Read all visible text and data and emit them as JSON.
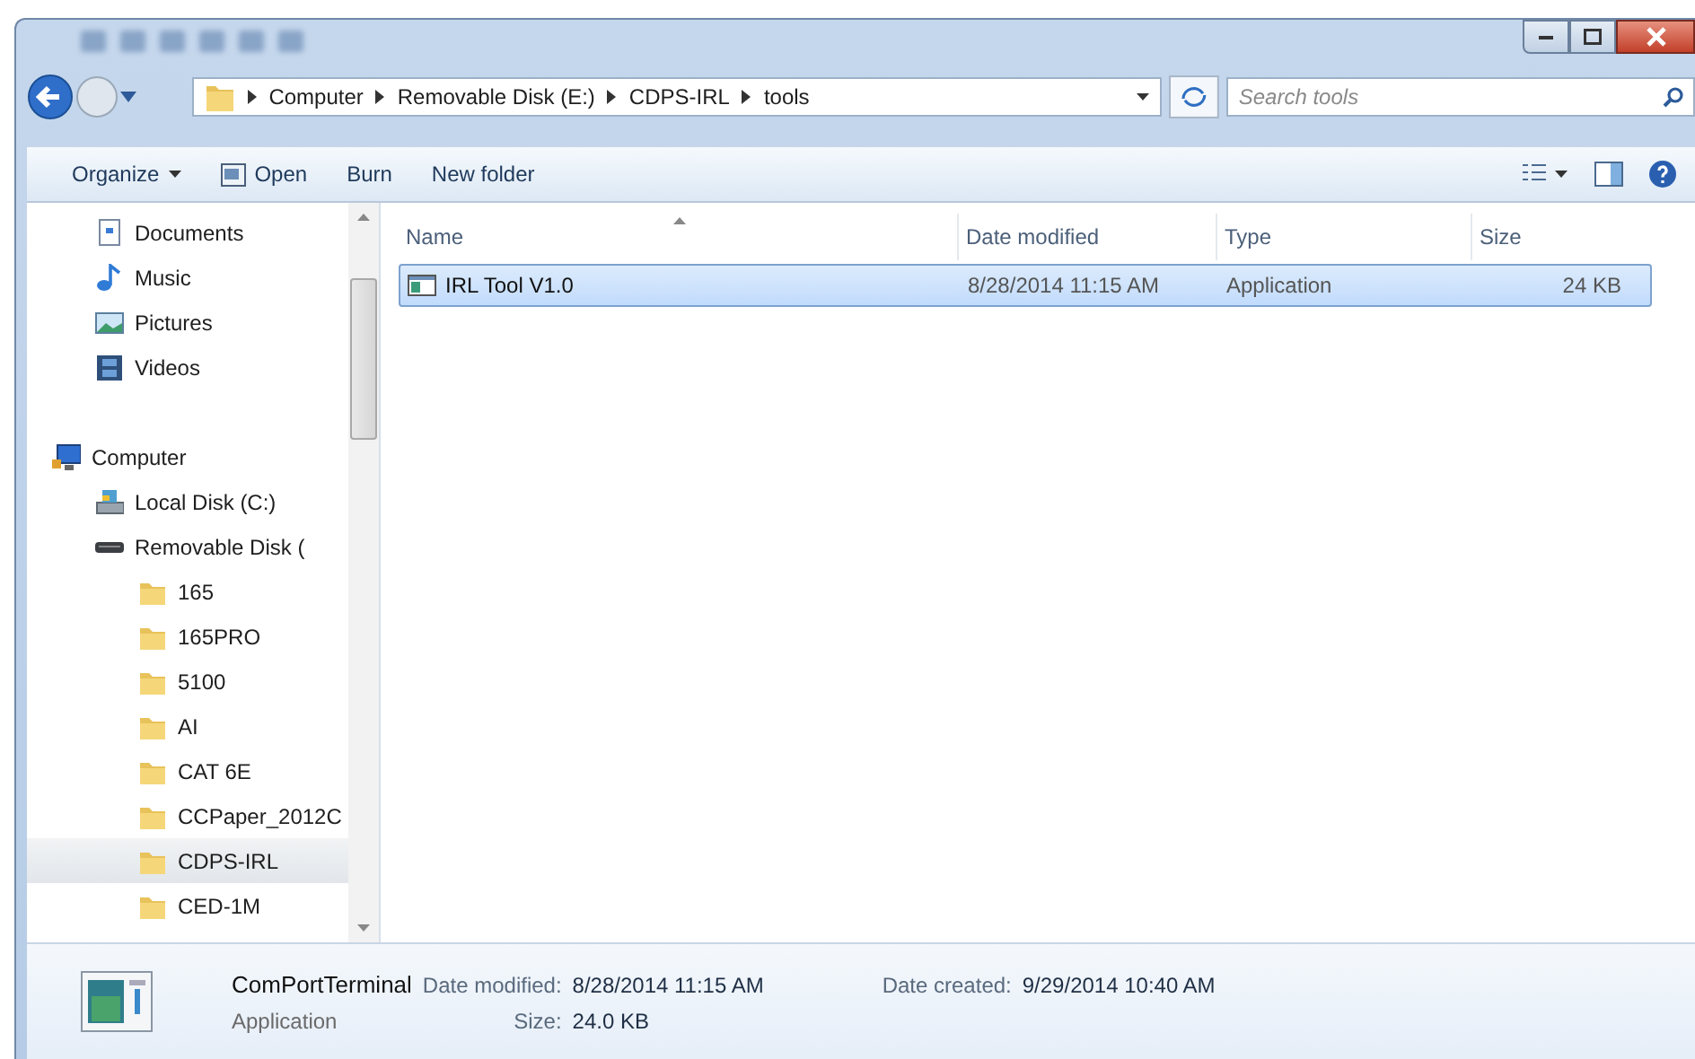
{
  "address_bar": {
    "segments": [
      "Computer",
      "Removable Disk (E:)",
      "CDPS-IRL",
      "tools"
    ]
  },
  "search": {
    "placeholder": "Search tools"
  },
  "toolbar": {
    "buttons": [
      {
        "label": "Organize",
        "kind": "menu"
      },
      {
        "label": "Open",
        "kind": "open"
      },
      {
        "label": "Burn",
        "kind": "plain"
      },
      {
        "label": "New folder",
        "kind": "plain"
      }
    ]
  },
  "sidebar": {
    "items": [
      {
        "label": "Documents",
        "kind": "documents",
        "selected": false
      },
      {
        "label": "Music",
        "kind": "music",
        "selected": false
      },
      {
        "label": "Pictures",
        "kind": "pictures",
        "selected": false
      },
      {
        "label": "Videos",
        "kind": "videos",
        "selected": false
      },
      {
        "label": "Computer",
        "kind": "computer",
        "selected": false,
        "children": [
          {
            "label": "Local Disk (C:)",
            "kind": "local-disk",
            "selected": false
          },
          {
            "label": "Removable Disk (",
            "kind": "removable-disk",
            "selected": false,
            "children": [
              {
                "label": "165",
                "kind": "folder",
                "selected": false
              },
              {
                "label": "165PRO",
                "kind": "folder",
                "selected": false
              },
              {
                "label": "5100",
                "kind": "folder",
                "selected": false
              },
              {
                "label": "AI",
                "kind": "folder",
                "selected": false
              },
              {
                "label": "CAT 6E",
                "kind": "folder",
                "selected": false
              },
              {
                "label": "CCPaper_2012C",
                "kind": "folder",
                "selected": false
              },
              {
                "label": "CDPS-IRL",
                "kind": "folder",
                "selected": true
              },
              {
                "label": "CED-1M",
                "kind": "folder",
                "selected": false
              }
            ]
          }
        ]
      }
    ]
  },
  "file_list": {
    "columns": [
      {
        "label": "Name",
        "sorted": true
      },
      {
        "label": "Date modified",
        "sorted": false
      },
      {
        "label": "Type",
        "sorted": false
      },
      {
        "label": "Size",
        "sorted": false
      }
    ],
    "rows": [
      {
        "name": "IRL Tool V1.0",
        "date_modified": "8/28/2014 11:15 AM",
        "type": "Application",
        "size": "24 KB",
        "selected": true
      }
    ]
  },
  "details_pane": {
    "name": "ComPortTerminal",
    "type": "Application",
    "fields": [
      {
        "label": "Date modified:",
        "value": "8/28/2014 11:15 AM"
      },
      {
        "label": "Size:",
        "value": "24.0 KB"
      },
      {
        "label": "Date created:",
        "value": "9/29/2014 10:40 AM"
      }
    ]
  }
}
